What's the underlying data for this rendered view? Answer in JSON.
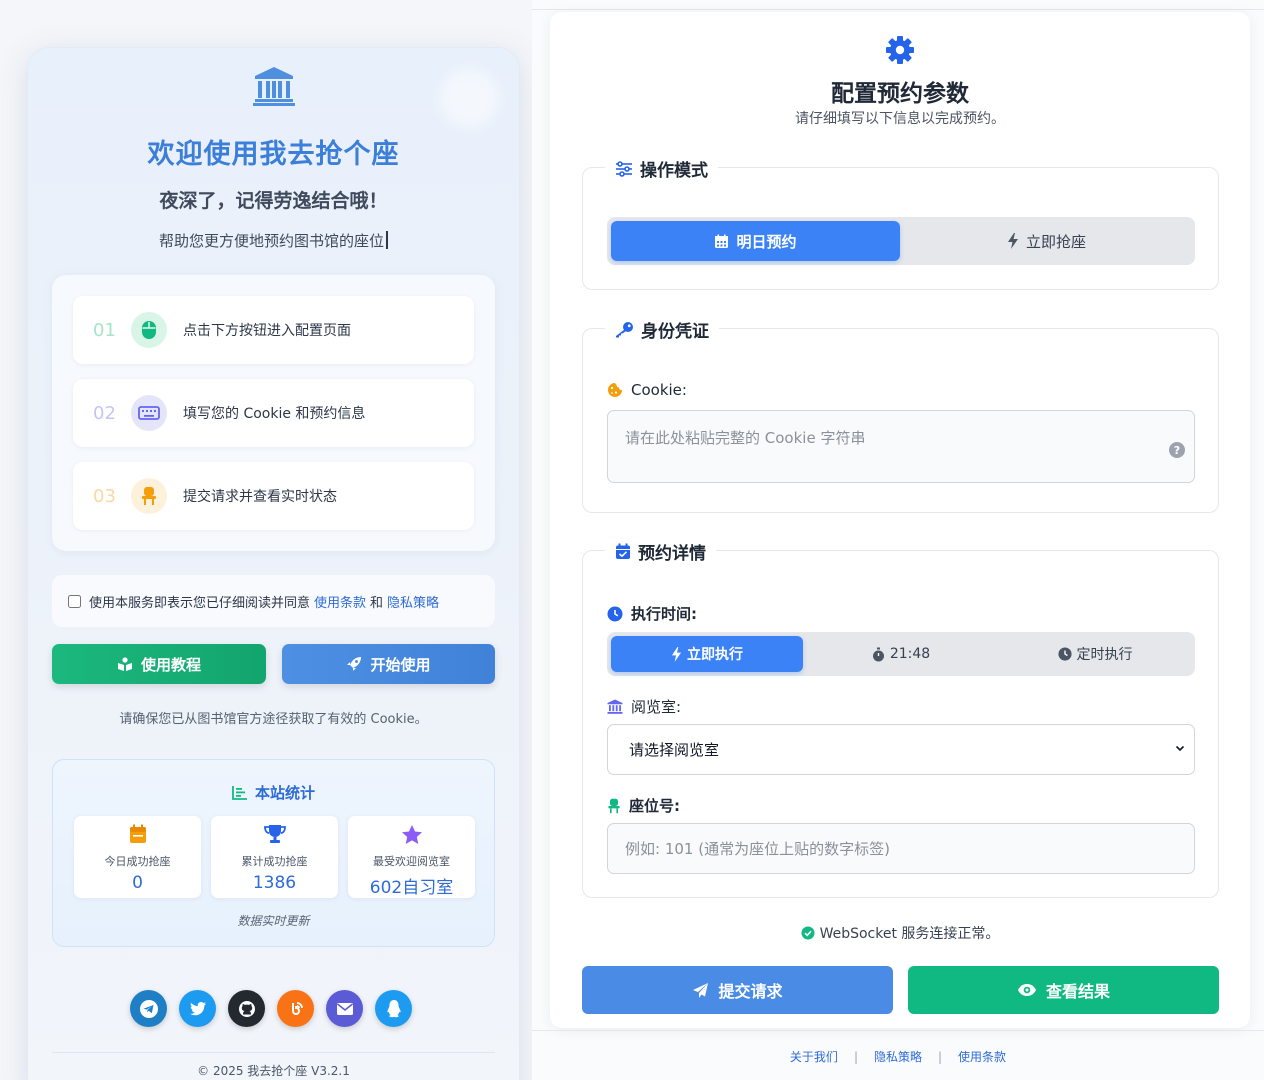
{
  "left": {
    "title": "欢迎使用我去抢个座",
    "greeting": "夜深了，记得劳逸结合哦！",
    "subtitle": "帮助您更方便地预约图书馆的座位",
    "steps": [
      {
        "num": "01",
        "text": "点击下方按钮进入配置页面",
        "icon": "mouse-icon",
        "color": "#10b981"
      },
      {
        "num": "02",
        "text": "填写您的 Cookie 和预约信息",
        "icon": "keyboard-icon",
        "color": "#6366f1"
      },
      {
        "num": "03",
        "text": "提交请求并查看实时状态",
        "icon": "chair-icon",
        "color": "#f59e0b"
      }
    ],
    "agree": {
      "text": "使用本服务即表示您已仔细阅读并同意",
      "terms": "使用条款",
      "and": "和",
      "privacy": "隐私策略"
    },
    "buttons": {
      "tutorial": "使用教程",
      "start": "开始使用"
    },
    "cookie_note": "请确保您已从图书馆官方途径获取了有效的 Cookie。",
    "stats": {
      "title": "本站统计",
      "items": [
        {
          "label": "今日成功抢座",
          "value": "0",
          "icon": "calendar-icon"
        },
        {
          "label": "累计成功抢座",
          "value": "1386",
          "icon": "trophy-icon"
        },
        {
          "label": "最受欢迎阅览室",
          "value": "602自习室",
          "icon": "star-icon"
        }
      ],
      "footnote": "数据实时更新"
    },
    "social": [
      "telegram-icon",
      "twitter-icon",
      "github-icon",
      "blog-icon",
      "email-icon",
      "qq-icon"
    ],
    "copyright": "© 2025 我去抢个座 V3.2.1"
  },
  "right": {
    "title": "配置预约参数",
    "subtitle": "请仔细填写以下信息以完成预约。",
    "mode": {
      "legend": "操作模式",
      "options": [
        "明日预约",
        "立即抢座"
      ],
      "selected": "明日预约"
    },
    "credential": {
      "legend": "身份凭证",
      "cookie_label": "Cookie:",
      "cookie_placeholder": "请在此处粘贴完整的 Cookie 字符串"
    },
    "details": {
      "legend": "预约详情",
      "time_label": "执行时间:",
      "time_options": [
        "立即执行",
        "21:48",
        "定时执行"
      ],
      "time_selected": "立即执行",
      "room_label": "阅览室:",
      "room_selected": "请选择阅览室",
      "seat_label": "座位号:",
      "seat_placeholder": "例如: 101 (通常为座位上贴的数字标签)"
    },
    "ws_status": "WebSocket 服务连接正常。",
    "buttons": {
      "submit": "提交请求",
      "view": "查看结果"
    },
    "footer": [
      "关于我们",
      "隐私策略",
      "使用条款"
    ]
  }
}
